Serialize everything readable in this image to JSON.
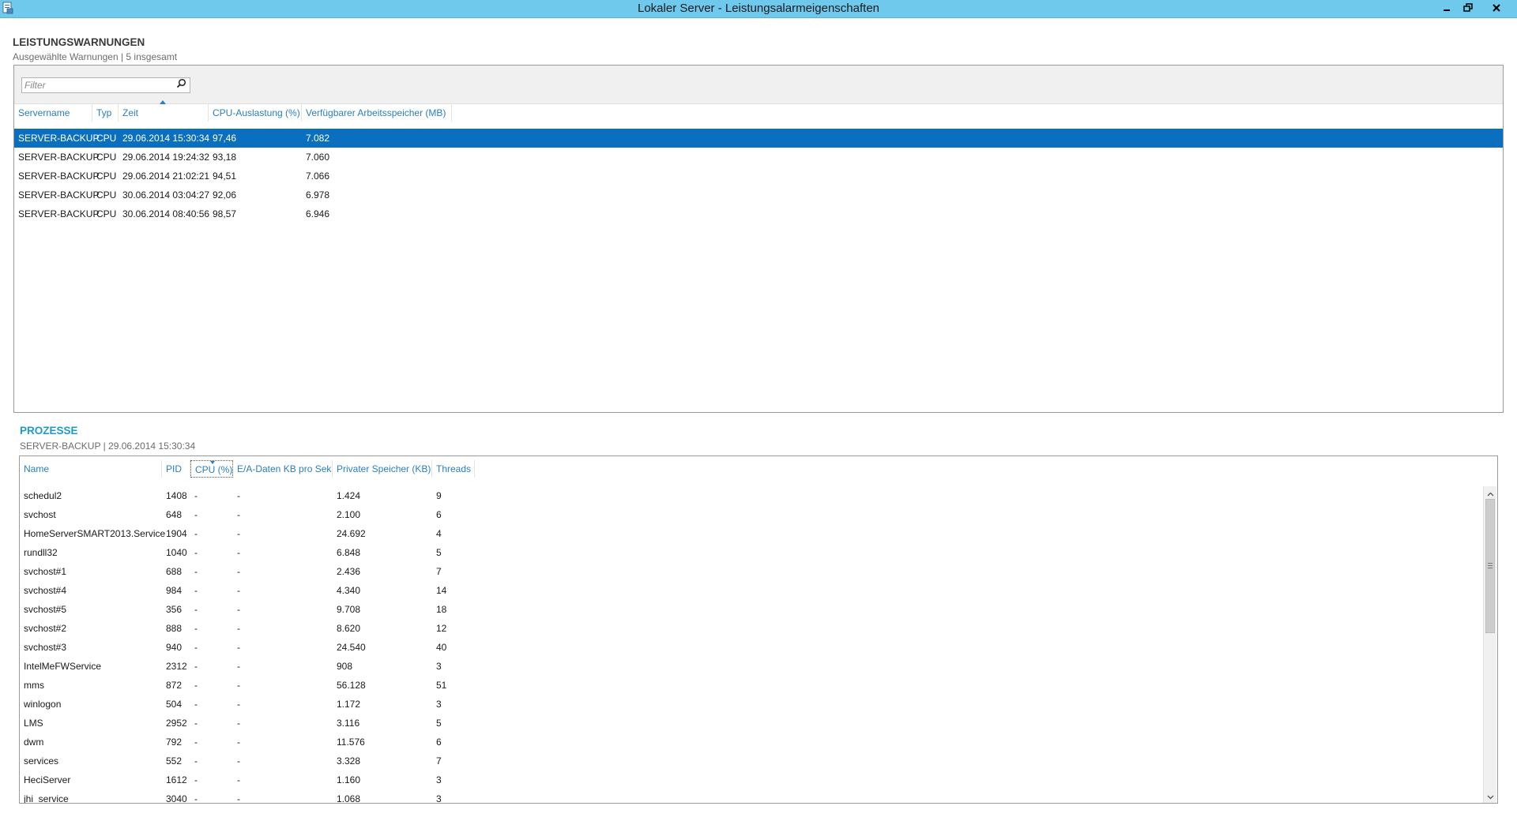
{
  "window": {
    "title": "Lokaler Server - Leistungsalarmeigenschaften",
    "icon": "server-properties-icon",
    "buttons": [
      "minimize-icon",
      "restore-icon",
      "close-icon"
    ]
  },
  "warnings": {
    "title": "LEISTUNGSWARNUNGEN",
    "subtitle": "Ausgewählte Warnungen | 5 insgesamt",
    "filter_placeholder": "Filter",
    "columns": [
      "Servername",
      "Typ",
      "Zeit",
      "CPU-Auslastung (%)",
      "Verfügbarer Arbeitsspeicher (MB)"
    ],
    "sorted_column": "Zeit",
    "rows": [
      {
        "server": "SERVER-BACKUP",
        "type": "CPU",
        "time": "29.06.2014 15:30:34",
        "cpu": "97,46",
        "memory": "7.082",
        "selected": true
      },
      {
        "server": "SERVER-BACKUP",
        "type": "CPU",
        "time": "29.06.2014 19:24:32",
        "cpu": "93,18",
        "memory": "7.060"
      },
      {
        "server": "SERVER-BACKUP",
        "type": "CPU",
        "time": "29.06.2014 21:02:21",
        "cpu": "94,51",
        "memory": "7.066"
      },
      {
        "server": "SERVER-BACKUP",
        "type": "CPU",
        "time": "30.06.2014 03:04:27",
        "cpu": "92,06",
        "memory": "6.978"
      },
      {
        "server": "SERVER-BACKUP",
        "type": "CPU",
        "time": "30.06.2014 08:40:56",
        "cpu": "98,57",
        "memory": "6.946"
      }
    ]
  },
  "processes": {
    "title": "PROZESSE",
    "subtitle": "SERVER-BACKUP  |  29.06.2014 15:30:34",
    "columns": [
      "Name",
      "PID",
      "CPU (%)",
      "E/A-Daten KB pro Sek.",
      "Privater Speicher (KB)",
      "Threads"
    ],
    "sorted_column": "CPU (%)",
    "rows": [
      {
        "name": "schedul2",
        "pid": "1408",
        "cpu": "-",
        "io": "-",
        "mem": "1.424",
        "threads": "9"
      },
      {
        "name": "svchost",
        "pid": "648",
        "cpu": "-",
        "io": "-",
        "mem": "2.100",
        "threads": "6"
      },
      {
        "name": "HomeServerSMART2013.Service",
        "pid": "1904",
        "cpu": "-",
        "io": "-",
        "mem": "24.692",
        "threads": "4"
      },
      {
        "name": "rundll32",
        "pid": "1040",
        "cpu": "-",
        "io": "-",
        "mem": "6.848",
        "threads": "5"
      },
      {
        "name": "svchost#1",
        "pid": "688",
        "cpu": "-",
        "io": "-",
        "mem": "2.436",
        "threads": "7"
      },
      {
        "name": "svchost#4",
        "pid": "984",
        "cpu": "-",
        "io": "-",
        "mem": "4.340",
        "threads": "14"
      },
      {
        "name": "svchost#5",
        "pid": "356",
        "cpu": "-",
        "io": "-",
        "mem": "9.708",
        "threads": "18"
      },
      {
        "name": "svchost#2",
        "pid": "888",
        "cpu": "-",
        "io": "-",
        "mem": "8.620",
        "threads": "12"
      },
      {
        "name": "svchost#3",
        "pid": "940",
        "cpu": "-",
        "io": "-",
        "mem": "24.540",
        "threads": "40"
      },
      {
        "name": "IntelMeFWService",
        "pid": "2312",
        "cpu": "-",
        "io": "-",
        "mem": "908",
        "threads": "3"
      },
      {
        "name": "mms",
        "pid": "872",
        "cpu": "-",
        "io": "-",
        "mem": "56.128",
        "threads": "51"
      },
      {
        "name": "winlogon",
        "pid": "504",
        "cpu": "-",
        "io": "-",
        "mem": "1.172",
        "threads": "3"
      },
      {
        "name": "LMS",
        "pid": "2952",
        "cpu": "-",
        "io": "-",
        "mem": "3.116",
        "threads": "5"
      },
      {
        "name": "dwm",
        "pid": "792",
        "cpu": "-",
        "io": "-",
        "mem": "11.576",
        "threads": "6"
      },
      {
        "name": "services",
        "pid": "552",
        "cpu": "-",
        "io": "-",
        "mem": "3.328",
        "threads": "7"
      },
      {
        "name": "HeciServer",
        "pid": "1612",
        "cpu": "-",
        "io": "-",
        "mem": "1.160",
        "threads": "3"
      },
      {
        "name": "jhi_service",
        "pid": "3040",
        "cpu": "-",
        "io": "-",
        "mem": "1.068",
        "threads": "3"
      }
    ]
  },
  "colors": {
    "titlebar": "#6ec9ec",
    "selection": "#0a6fbf",
    "header_text": "#2a7fbd",
    "section_accent": "#1f9ac7"
  }
}
